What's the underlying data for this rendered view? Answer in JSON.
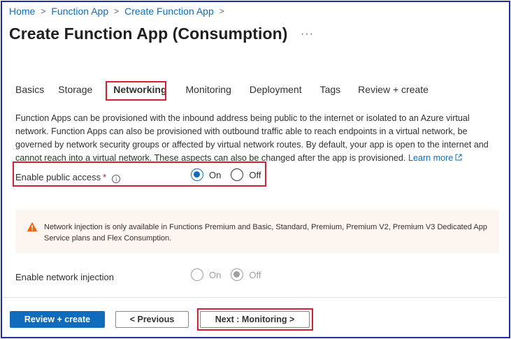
{
  "breadcrumb": [
    "Home",
    "Function App",
    "Create Function App"
  ],
  "title": "Create Function App (Consumption)",
  "more": "···",
  "tabs": [
    "Basics",
    "Storage",
    "Networking",
    "Monitoring",
    "Deployment",
    "Tags",
    "Review + create"
  ],
  "active_tab": "Networking",
  "description": {
    "text": "Function Apps can be provisioned with the inbound address being public to the internet or isolated to an Azure virtual network. Function Apps can also be provisioned with outbound traffic able to reach endpoints in a virtual network, be governed by network security groups or affected by virtual network routes. By default, your app is open to the internet and cannot reach into a virtual network. These aspects can also be changed after the app is provisioned.",
    "learn_more": "Learn more"
  },
  "public_access": {
    "label": "Enable public access",
    "required_mark": "*",
    "info": "i",
    "options": [
      "On",
      "Off"
    ],
    "selected": "On"
  },
  "warning": {
    "text": "Network injection is only available in Functions Premium and Basic, Standard, Premium, Premium V2, Premium V3 Dedicated App Service plans and Flex Consumption."
  },
  "network_injection": {
    "label": "Enable network injection",
    "options": [
      "On",
      "Off"
    ],
    "selected": "Off",
    "disabled": true
  },
  "footer": {
    "review_create": "Review + create",
    "previous": "< Previous",
    "next": "Next : Monitoring >"
  },
  "colors": {
    "accent": "#0f6cbd",
    "highlight": "#d61f2f",
    "warning_bg": "#fdf6f0",
    "warning_icon": "#f7630c"
  }
}
